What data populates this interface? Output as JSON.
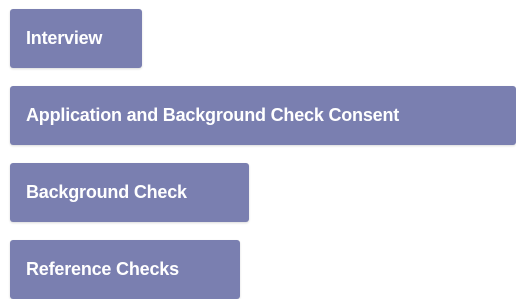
{
  "steps": [
    {
      "label": "Interview"
    },
    {
      "label": "Application and Background Check Consent"
    },
    {
      "label": "Background Check"
    },
    {
      "label": "Reference Checks"
    }
  ],
  "colors": {
    "button_bg": "#7a7fb0",
    "button_text": "#ffffff"
  }
}
